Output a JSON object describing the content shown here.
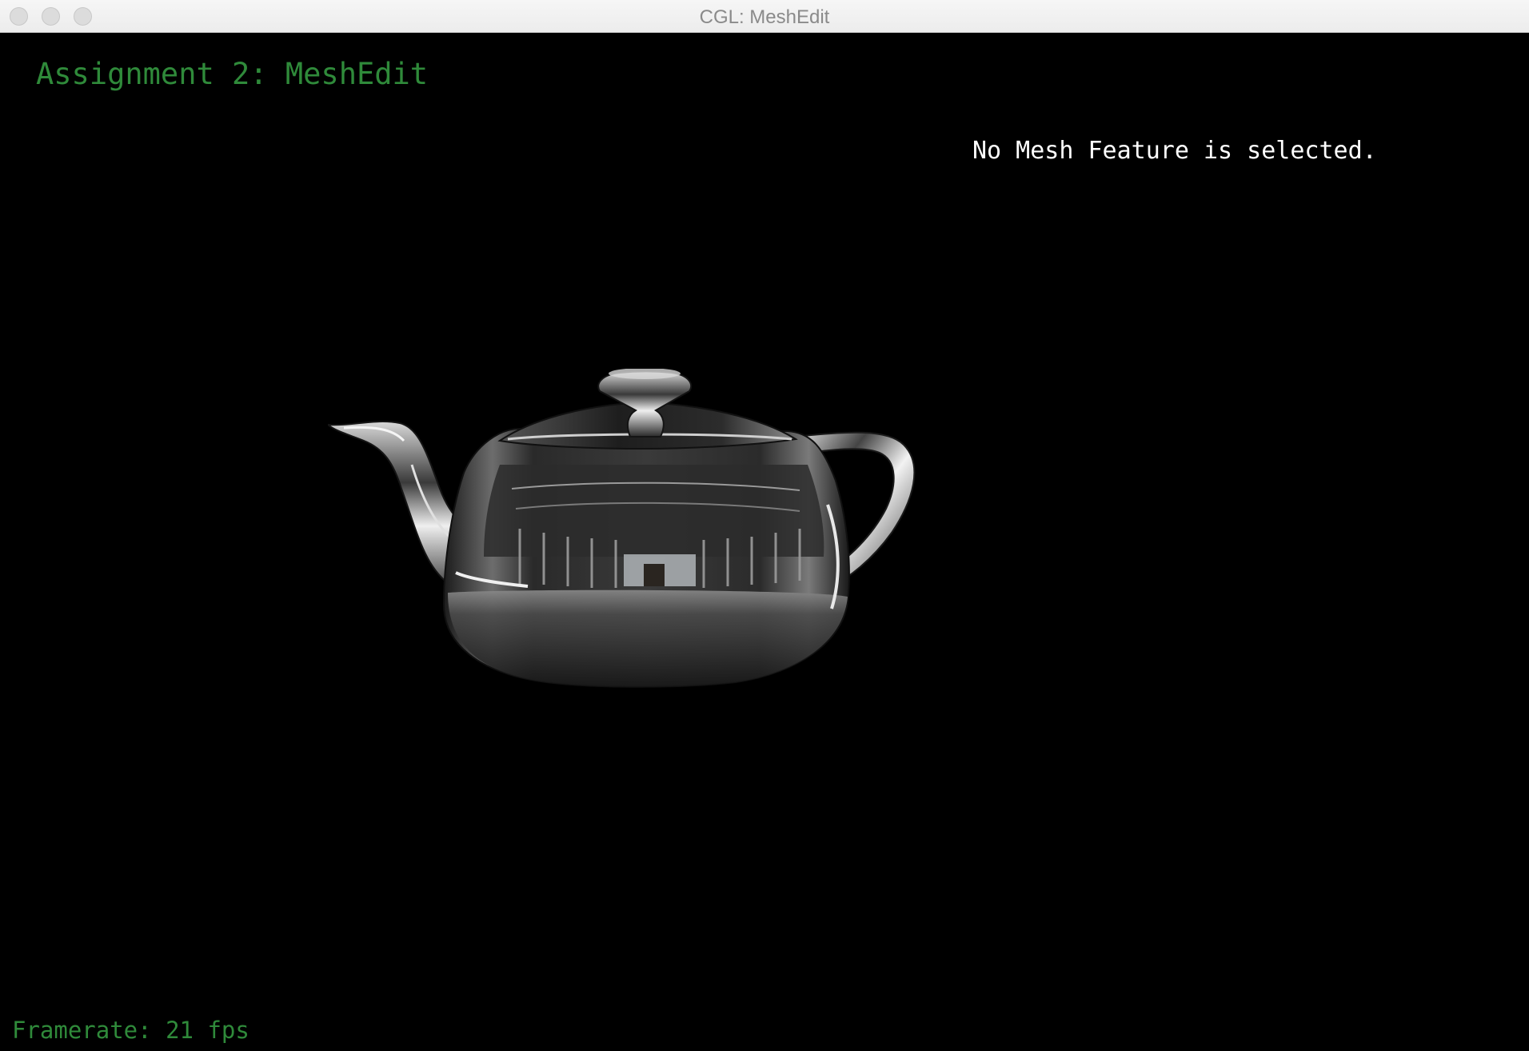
{
  "window": {
    "title": "CGL: MeshEdit"
  },
  "overlay": {
    "assignment_title": "Assignment 2: MeshEdit",
    "selection_status": "No Mesh Feature is selected.",
    "framerate_label": "Framerate:",
    "framerate_value": "21",
    "framerate_unit": "fps"
  },
  "colors": {
    "overlay_green": "#2f8a3a",
    "overlay_white": "#ffffff",
    "background": "#000000"
  },
  "scene": {
    "model": "teapot",
    "material": "mirror-environment-map"
  }
}
